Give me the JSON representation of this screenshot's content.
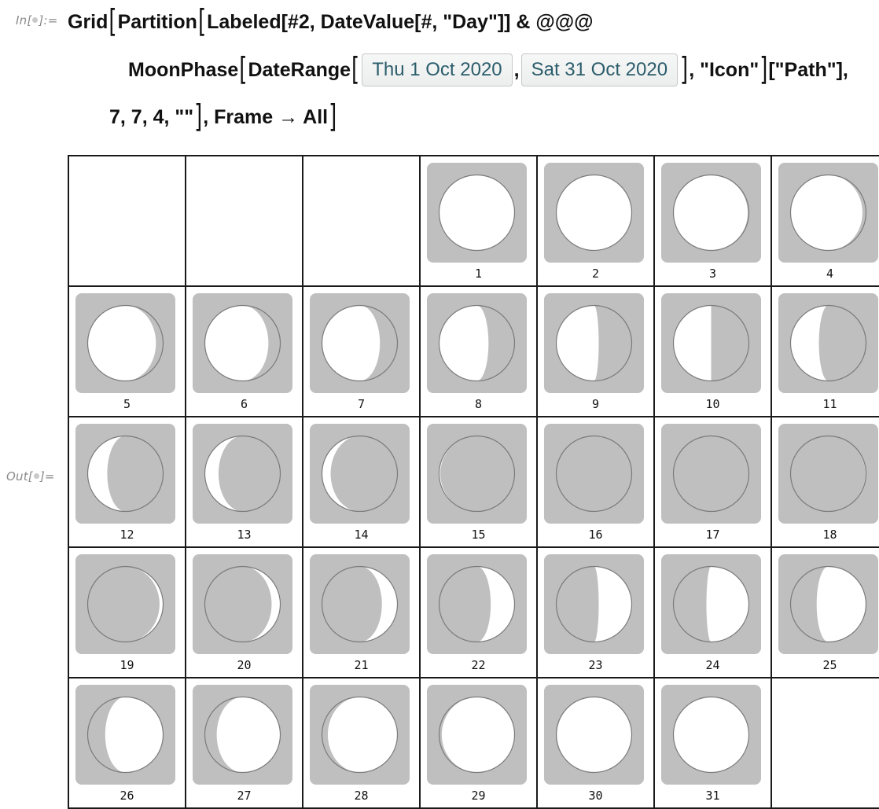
{
  "notebook": {
    "in_label": "In[",
    "in_label_end": "]:=",
    "out_label": "Out[",
    "out_label_end": "]="
  },
  "code": {
    "line1": {
      "t1": "Grid",
      "t2": "Partition",
      "t3": "Labeled[#2, DateValue[#, \"Day\"]] & @@@"
    },
    "line2": {
      "t1": "MoonPhase",
      "t2": "DateRange",
      "date_start": "Thu 1 Oct 2020",
      "sep": ",",
      "date_end": "Sat 31 Oct 2020",
      "t3": ", \"Icon\"",
      "t4": "[\"Path\"],"
    },
    "line3": {
      "t1": "7, 7, 4, \"\"",
      "t2": ", Frame → All"
    }
  },
  "colors": {
    "icon_background": "#bfbfbf",
    "moon_lit": "#ffffff",
    "moon_dark": "#bfbfbf",
    "moon_outline": "#7a7a7a",
    "date_text": "#2b5d6b"
  },
  "calendar": {
    "columns": 7,
    "leading_blank_cells": 3,
    "days": [
      {
        "label": "1",
        "phase": 0.5
      },
      {
        "label": "2",
        "phase": 0.51
      },
      {
        "label": "3",
        "phase": 0.54
      },
      {
        "label": "4",
        "phase": 0.57
      },
      {
        "label": "5",
        "phase": 0.6
      },
      {
        "label": "6",
        "phase": 0.63
      },
      {
        "label": "7",
        "phase": 0.66
      },
      {
        "label": "8",
        "phase": 0.7
      },
      {
        "label": "9",
        "phase": 0.73
      },
      {
        "label": "10",
        "phase": 0.75
      },
      {
        "label": "11",
        "phase": 0.79
      },
      {
        "label": "12",
        "phase": 0.83
      },
      {
        "label": "13",
        "phase": 0.86
      },
      {
        "label": "14",
        "phase": 0.89
      },
      {
        "label": "15",
        "phase": 0.96
      },
      {
        "label": "16",
        "phase": 0.0
      },
      {
        "label": "17",
        "phase": 0.01
      },
      {
        "label": "18",
        "phase": 0.03
      },
      {
        "label": "19",
        "phase": 0.07
      },
      {
        "label": "20",
        "phase": 0.11
      },
      {
        "label": "21",
        "phase": 0.15
      },
      {
        "label": "22",
        "phase": 0.19
      },
      {
        "label": "23",
        "phase": 0.23
      },
      {
        "label": "24",
        "phase": 0.27
      },
      {
        "label": "25",
        "phase": 0.3
      },
      {
        "label": "26",
        "phase": 0.34
      },
      {
        "label": "27",
        "phase": 0.37
      },
      {
        "label": "28",
        "phase": 0.41
      },
      {
        "label": "29",
        "phase": 0.44
      },
      {
        "label": "30",
        "phase": 0.47
      },
      {
        "label": "31",
        "phase": 0.5
      }
    ]
  }
}
